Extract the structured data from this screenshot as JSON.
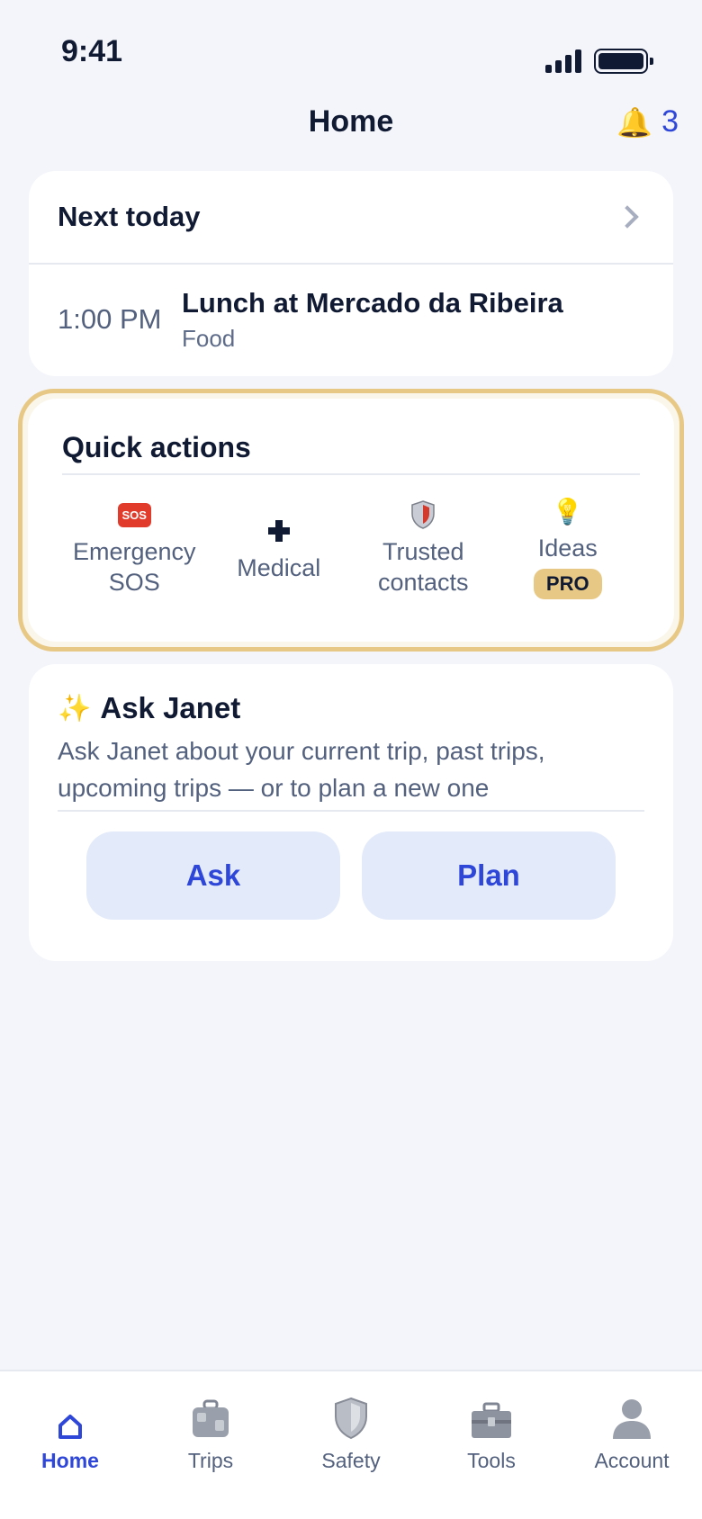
{
  "status": {
    "time": "9:41"
  },
  "header": {
    "title": "Home",
    "notification_count": "3"
  },
  "next_today": {
    "title": "Next today",
    "event": {
      "time": "1:00 PM",
      "name": "Lunch at Mercado da Ribeira",
      "category": "Food"
    }
  },
  "quick_actions": {
    "title": "Quick actions",
    "items": [
      {
        "line1": "Emergency",
        "line2": "SOS",
        "icon": "sos-icon",
        "badge_text": "SOS"
      },
      {
        "line1": "Medical",
        "icon": "medical-cross-icon"
      },
      {
        "line1": "Trusted",
        "line2": "contacts",
        "icon": "shield-icon"
      },
      {
        "line1": "Ideas",
        "icon": "lightbulb-icon",
        "badge": "PRO"
      }
    ]
  },
  "ask_janet": {
    "title": "Ask Janet",
    "description": "Ask Janet about your current trip, past trips, upcoming trips — or to plan a new one",
    "ask_label": "Ask",
    "plan_label": "Plan"
  },
  "tabs": [
    {
      "label": "Home",
      "icon": "home-icon",
      "active": true
    },
    {
      "label": "Trips",
      "icon": "luggage-icon"
    },
    {
      "label": "Safety",
      "icon": "shield-icon"
    },
    {
      "label": "Tools",
      "icon": "toolbox-icon"
    },
    {
      "label": "Account",
      "icon": "person-icon"
    }
  ],
  "colors": {
    "accent": "#2f47d8",
    "highlight": "#e8c885",
    "background": "#f3f5fa"
  }
}
